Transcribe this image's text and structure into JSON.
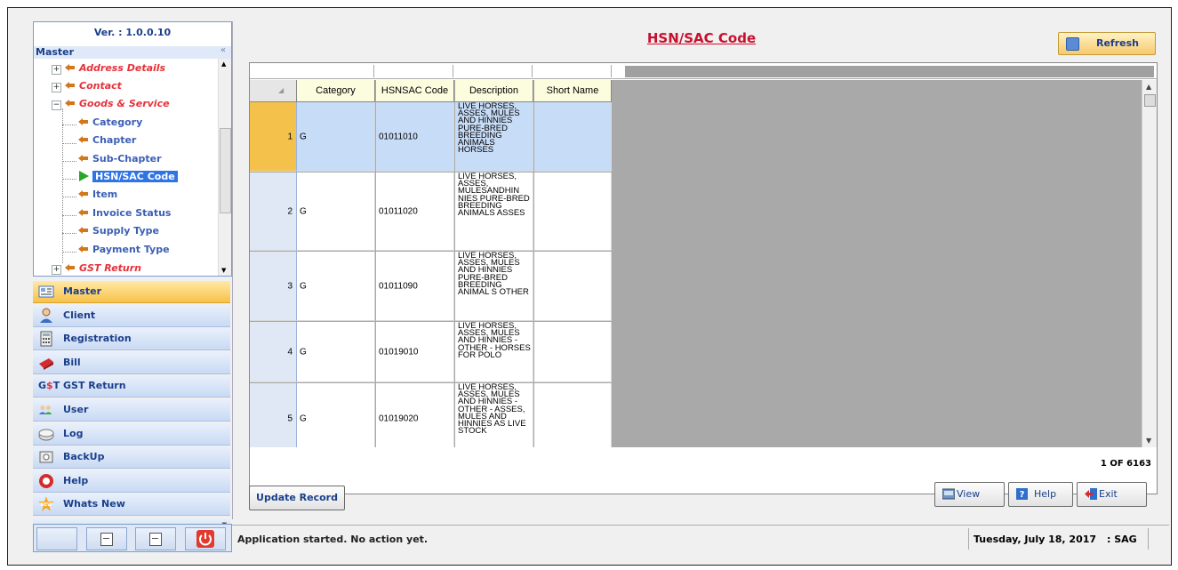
{
  "sidebar": {
    "version": "Ver. : 1.0.0.10",
    "header": "Master",
    "collapse_glyph": "«",
    "tree": [
      {
        "label": "Address Details",
        "style": "red",
        "level": 0,
        "expand": "+"
      },
      {
        "label": "Contact",
        "style": "red",
        "level": 0,
        "expand": "+"
      },
      {
        "label": "Goods & Service",
        "style": "red",
        "level": 0,
        "expand": "-"
      },
      {
        "label": "Category",
        "style": "blue",
        "level": 1
      },
      {
        "label": "Chapter",
        "style": "blue",
        "level": 1
      },
      {
        "label": "Sub-Chapter",
        "style": "blue",
        "level": 1
      },
      {
        "label": "HSN/SAC Code",
        "style": "blue",
        "level": 1,
        "selected": true
      },
      {
        "label": "Item",
        "style": "blue",
        "level": 1
      },
      {
        "label": "Invoice Status",
        "style": "blue",
        "level": 1
      },
      {
        "label": "Supply Type",
        "style": "blue",
        "level": 1
      },
      {
        "label": "Payment Type",
        "style": "blue",
        "level": 1
      },
      {
        "label": "GST Return",
        "style": "red",
        "level": 0,
        "expand": "+"
      }
    ],
    "nav": [
      {
        "label": "Master",
        "icon": "master-icon",
        "active": true
      },
      {
        "label": "Client",
        "icon": "client-icon"
      },
      {
        "label": "Registration",
        "icon": "registration-icon"
      },
      {
        "label": "Bill",
        "icon": "bill-icon"
      },
      {
        "label": "GST Return",
        "icon": "gst-icon"
      },
      {
        "label": "User",
        "icon": "user-icon"
      },
      {
        "label": "Log",
        "icon": "log-icon"
      },
      {
        "label": "BackUp",
        "icon": "backup-icon"
      },
      {
        "label": "Help",
        "icon": "help-icon"
      },
      {
        "label": "Whats New",
        "icon": "new-icon"
      }
    ]
  },
  "main": {
    "title": "HSN/SAC Code",
    "refresh_label": "Refresh",
    "columns": [
      "Category",
      "HSNSAC Code",
      "Description",
      "Short Name"
    ],
    "rows": [
      {
        "num": "1",
        "category": "G",
        "code": "01011010",
        "description": "LIVE HORSES, ASSES, MULES AND HINNIES PURE-BRED BREEDING ANIMALS HORSES",
        "short_name": ""
      },
      {
        "num": "2",
        "category": "G",
        "code": "01011020",
        "description": "LIVE HORSES, ASSES, MULESANDHIN NIES PURE-BRED BREEDING ANIMALS ASSES",
        "short_name": ""
      },
      {
        "num": "3",
        "category": "G",
        "code": "01011090",
        "description": "LIVE HORSES, ASSES, MULES AND HINNIES PURE-BRED BREEDING ANIMAL S OTHER",
        "short_name": ""
      },
      {
        "num": "4",
        "category": "G",
        "code": "01019010",
        "description": "LIVE HORSES, ASSES, MULES AND HINNIES - OTHER - HORSES FOR POLO",
        "short_name": ""
      },
      {
        "num": "5",
        "category": "G",
        "code": "01019020",
        "description": "LIVE HORSES, ASSES, MULES AND HINNIES - OTHER - ASSES, MULES AND HINNIES AS LIVE STOCK",
        "short_name": ""
      }
    ],
    "pager": "1 OF 6163",
    "update_label": "Update Record",
    "view_label": "View",
    "help_label": "Help",
    "exit_label": "Exit"
  },
  "status": {
    "message": "Application started. No action yet.",
    "date": "Tuesday, July 18, 2017",
    "user": ": SAG"
  },
  "colors": {
    "title_red": "#c8102e",
    "selection_blue": "#2f74e6",
    "accent_orange": "#f7c24a",
    "nav_text": "#1b3f8b"
  }
}
